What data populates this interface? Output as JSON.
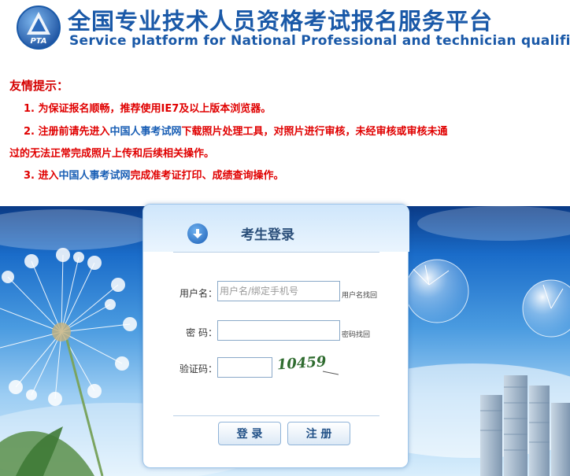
{
  "header": {
    "title_cn": "全国专业技术人员资格考试报名服务平台",
    "title_en": "Service platform for National Professional and technician qualification test",
    "logo_text": "PTA"
  },
  "notice": {
    "title": "友情提示：",
    "line1": "1. 为保证报名顺畅，推荐使用IE7及以上版本浏览器。",
    "line2_a": "2. 注册前请先进入",
    "line2_link": "中国人事考试网",
    "line2_b": "下载照片处理工具，对照片进行审核，未经审核或审核未通",
    "line2_c": "过的无法正常完成照片上传和后续相关操作。",
    "line3_a": "3. 进入",
    "line3_link": "中国人事考试网",
    "line3_b": "完成准考证打印、成绩查询操作。"
  },
  "login": {
    "title": "考生登录",
    "username_label": "用户名：",
    "username_placeholder": "用户名/绑定手机号",
    "username_recover": "用户名找回",
    "password_label": "密  码：",
    "password_recover": "密码找回",
    "captcha_label": "验证码：",
    "captcha_text": "10459",
    "login_button": "登 录",
    "register_button": "注 册"
  },
  "colors": {
    "brand_blue": "#1a59a8",
    "notice_red": "#e00000",
    "link_blue": "#1a5fb5"
  }
}
